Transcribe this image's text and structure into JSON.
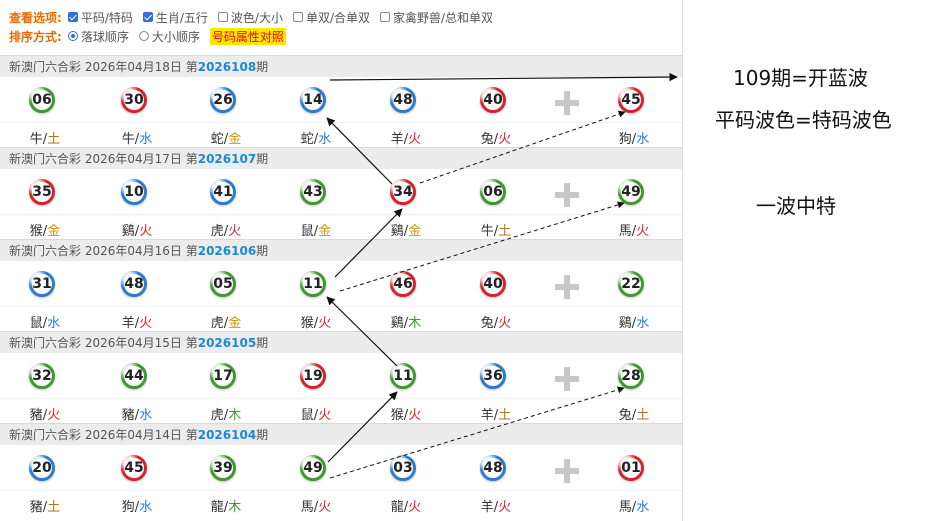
{
  "options": {
    "view_title": "查看选项:",
    "view_items": [
      {
        "label": "平码/特码",
        "checked": true
      },
      {
        "label": "生肖/五行",
        "checked": true
      },
      {
        "label": "波色/大小",
        "checked": false
      },
      {
        "label": "单双/合单双",
        "checked": false
      },
      {
        "label": "家禽野兽/总和单双",
        "checked": false
      }
    ],
    "sort_title": "排序方式:",
    "sort_items": [
      {
        "label": "落球顺序",
        "selected": true
      },
      {
        "label": "大小顺序",
        "selected": false
      }
    ],
    "compare_button": "号码属性对照"
  },
  "draws": [
    {
      "header": "新澳门六合彩 2026年04月18日 第",
      "issue": "2026108",
      "suffix": "期",
      "balls": [
        {
          "num": "06",
          "color": "green",
          "zodiac": "牛",
          "element": "土"
        },
        {
          "num": "30",
          "color": "red",
          "zodiac": "牛",
          "element": "水"
        },
        {
          "num": "26",
          "color": "blue",
          "zodiac": "蛇",
          "element": "金"
        },
        {
          "num": "14",
          "color": "blue",
          "zodiac": "蛇",
          "element": "水"
        },
        {
          "num": "48",
          "color": "blue",
          "zodiac": "羊",
          "element": "火"
        },
        {
          "num": "40",
          "color": "red",
          "zodiac": "兔",
          "element": "火"
        },
        {
          "num": "45",
          "color": "red",
          "zodiac": "狗",
          "element": "水"
        }
      ]
    },
    {
      "header": "新澳门六合彩 2026年04月17日 第",
      "issue": "2026107",
      "suffix": "期",
      "balls": [
        {
          "num": "35",
          "color": "red",
          "zodiac": "猴",
          "element": "金"
        },
        {
          "num": "10",
          "color": "blue",
          "zodiac": "鷄",
          "element": "火"
        },
        {
          "num": "41",
          "color": "blue",
          "zodiac": "虎",
          "element": "火"
        },
        {
          "num": "43",
          "color": "green",
          "zodiac": "鼠",
          "element": "金"
        },
        {
          "num": "34",
          "color": "red",
          "zodiac": "鷄",
          "element": "金"
        },
        {
          "num": "06",
          "color": "green",
          "zodiac": "牛",
          "element": "土"
        },
        {
          "num": "49",
          "color": "green",
          "zodiac": "馬",
          "element": "火"
        }
      ]
    },
    {
      "header": "新澳门六合彩 2026年04月16日 第",
      "issue": "2026106",
      "suffix": "期",
      "balls": [
        {
          "num": "31",
          "color": "blue",
          "zodiac": "鼠",
          "element": "水"
        },
        {
          "num": "48",
          "color": "blue",
          "zodiac": "羊",
          "element": "火"
        },
        {
          "num": "05",
          "color": "green",
          "zodiac": "虎",
          "element": "金"
        },
        {
          "num": "11",
          "color": "green",
          "zodiac": "猴",
          "element": "火"
        },
        {
          "num": "46",
          "color": "red",
          "zodiac": "鷄",
          "element": "木"
        },
        {
          "num": "40",
          "color": "red",
          "zodiac": "兔",
          "element": "火"
        },
        {
          "num": "22",
          "color": "green",
          "zodiac": "鷄",
          "element": "水"
        }
      ]
    },
    {
      "header": "新澳门六合彩 2026年04月15日 第",
      "issue": "2026105",
      "suffix": "期",
      "balls": [
        {
          "num": "32",
          "color": "green",
          "zodiac": "豬",
          "element": "火"
        },
        {
          "num": "44",
          "color": "green",
          "zodiac": "豬",
          "element": "水"
        },
        {
          "num": "17",
          "color": "green",
          "zodiac": "虎",
          "element": "木"
        },
        {
          "num": "19",
          "color": "red",
          "zodiac": "鼠",
          "element": "火"
        },
        {
          "num": "11",
          "color": "green",
          "zodiac": "猴",
          "element": "火"
        },
        {
          "num": "36",
          "color": "blue",
          "zodiac": "羊",
          "element": "土"
        },
        {
          "num": "28",
          "color": "green",
          "zodiac": "兔",
          "element": "土"
        }
      ]
    },
    {
      "header": "新澳门六合彩 2026年04月14日 第",
      "issue": "2026104",
      "suffix": "期",
      "balls": [
        {
          "num": "20",
          "color": "blue",
          "zodiac": "豬",
          "element": "土"
        },
        {
          "num": "45",
          "color": "red",
          "zodiac": "狗",
          "element": "水"
        },
        {
          "num": "39",
          "color": "green",
          "zodiac": "龍",
          "element": "木"
        },
        {
          "num": "49",
          "color": "green",
          "zodiac": "馬",
          "element": "火"
        },
        {
          "num": "03",
          "color": "blue",
          "zodiac": "龍",
          "element": "火"
        },
        {
          "num": "48",
          "color": "blue",
          "zodiac": "羊",
          "element": "火"
        },
        {
          "num": "01",
          "color": "red",
          "zodiac": "馬",
          "element": "水"
        }
      ]
    }
  ],
  "annotations": {
    "line1": "109期=开蓝波",
    "line2": "平码波色=特码波色",
    "line3": "一波中特"
  },
  "colors": {
    "red": "#d6232b",
    "blue": "#2a7bd1",
    "green": "#3d9a2d",
    "issue_blue": "#1a8ad4",
    "option_orange": "#e86a00",
    "highlight_yellow": "#ffe700"
  }
}
